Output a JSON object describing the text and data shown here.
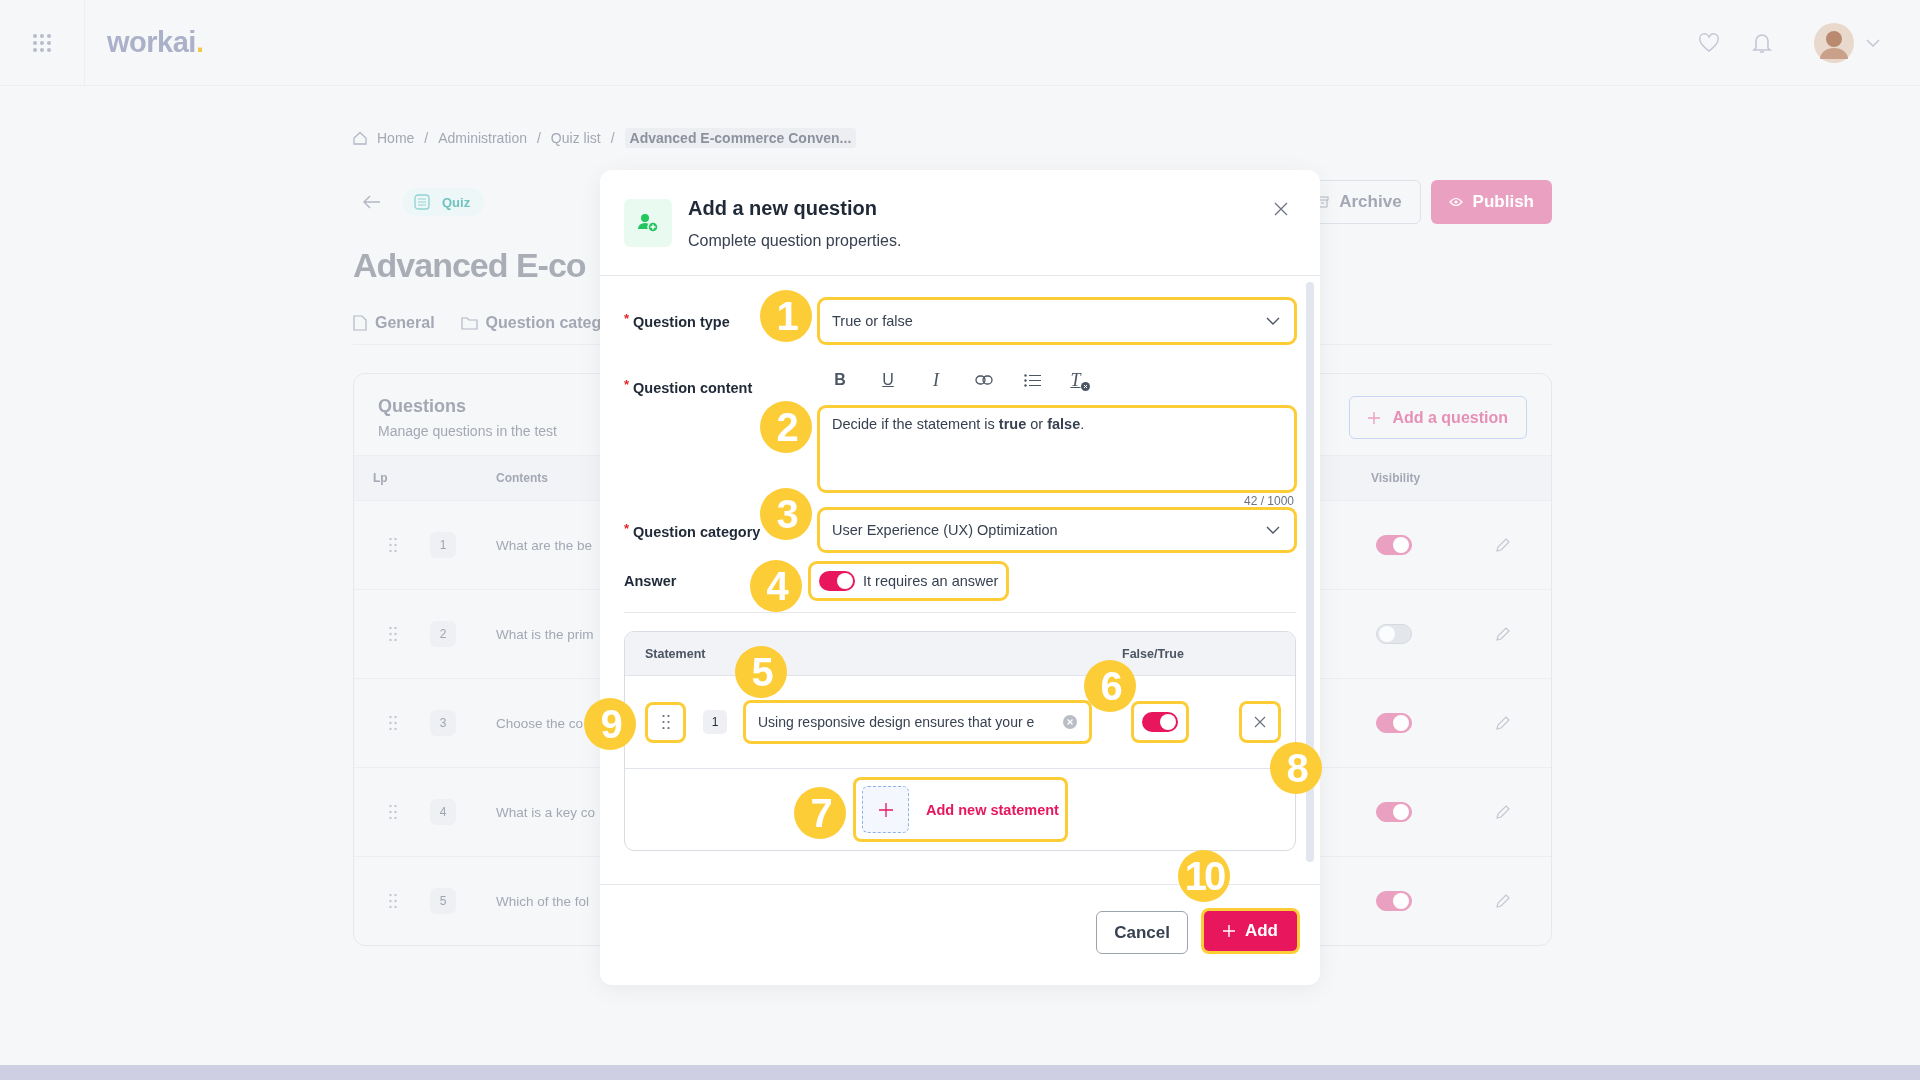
{
  "topbar": {
    "logo": "workai",
    "logo_mark": "."
  },
  "breadcrumb": [
    {
      "label": "Home",
      "current": false
    },
    {
      "label": "Administration",
      "current": false
    },
    {
      "label": "Quiz list",
      "current": false
    },
    {
      "label": "Advanced E-commerce Conven...",
      "current": true
    }
  ],
  "breadcrumb_separator": "/",
  "page": {
    "badge": "Quiz",
    "title": "Advanced E-co",
    "actions": [
      {
        "label": "Archive",
        "kind": "secondary"
      },
      {
        "label": "Publish",
        "kind": "primary"
      }
    ],
    "tabs": [
      {
        "label": "General",
        "kind": "file"
      },
      {
        "label": "Question categ",
        "kind": "folder"
      }
    ]
  },
  "questions_card": {
    "title": "Questions",
    "subtitle": "Manage questions in the test",
    "add_button": "Add a question",
    "columns": [
      "Lp",
      "Contents",
      "Visibility"
    ],
    "rows": [
      {
        "number": "1",
        "content": "What are the be",
        "visible": true
      },
      {
        "number": "2",
        "content": "What is the prim",
        "visible": false
      },
      {
        "number": "3",
        "content": "Choose the co",
        "visible": true
      },
      {
        "number": "4",
        "content": "What is a key co",
        "visible": true
      },
      {
        "number": "5",
        "content": "Which of the fol",
        "visible": true
      }
    ]
  },
  "modal": {
    "title": "Add a new question",
    "subtitle": "Complete question properties.",
    "question_type": {
      "label": "Question type",
      "mark": "*",
      "value": "True or false"
    },
    "question_content": {
      "label": "Question content",
      "mark": "*",
      "value": "Decide if the statement is **true** or **false**.",
      "counter": "42 / 1000",
      "toolbar": [
        {
          "kind": "bold",
          "glyph": "B"
        },
        {
          "kind": "underline",
          "glyph": "U"
        },
        {
          "kind": "italic",
          "glyph": "I"
        },
        {
          "kind": "link"
        },
        {
          "kind": "list"
        },
        {
          "kind": "clear",
          "glyph": "T"
        }
      ]
    },
    "question_category": {
      "label": "Question category",
      "mark": "*",
      "value": "User Experience (UX) Optimization"
    },
    "answer": {
      "label": "Answer",
      "toggle_label": "It requires an answer",
      "on": true
    },
    "statements": {
      "columns": [
        "Statement",
        "False/True"
      ],
      "rows": [
        {
          "number": "1",
          "value": "Using responsive design ensures that your e",
          "on": true
        }
      ],
      "add_label": "Add new statement"
    },
    "cancel": "Cancel",
    "add": "Add"
  },
  "callouts": [
    "1",
    "2",
    "3",
    "4",
    "5",
    "6",
    "7",
    "8",
    "9",
    "10"
  ]
}
